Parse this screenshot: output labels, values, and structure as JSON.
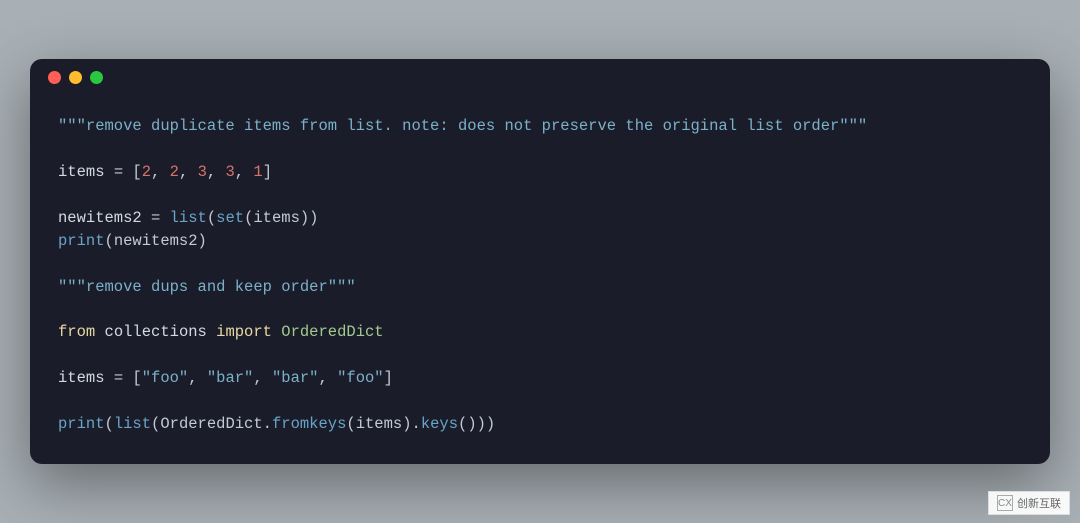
{
  "lines": [
    [
      {
        "cls": "t-str",
        "text": "\"\"\"remove duplicate items from list. note: does not preserve the original list order\"\"\""
      }
    ],
    [
      {
        "cls": "",
        "text": ""
      }
    ],
    [
      {
        "cls": "t-name",
        "text": "items "
      },
      {
        "cls": "t-punc",
        "text": "= ["
      },
      {
        "cls": "t-num",
        "text": "2"
      },
      {
        "cls": "t-punc",
        "text": ", "
      },
      {
        "cls": "t-num",
        "text": "2"
      },
      {
        "cls": "t-punc",
        "text": ", "
      },
      {
        "cls": "t-num",
        "text": "3"
      },
      {
        "cls": "t-punc",
        "text": ", "
      },
      {
        "cls": "t-num",
        "text": "3"
      },
      {
        "cls": "t-punc",
        "text": ", "
      },
      {
        "cls": "t-num",
        "text": "1"
      },
      {
        "cls": "t-punc",
        "text": "]"
      }
    ],
    [
      {
        "cls": "",
        "text": ""
      }
    ],
    [
      {
        "cls": "t-name",
        "text": "newitems2 "
      },
      {
        "cls": "t-punc",
        "text": "= "
      },
      {
        "cls": "t-fn",
        "text": "list"
      },
      {
        "cls": "t-punc",
        "text": "("
      },
      {
        "cls": "t-fn",
        "text": "set"
      },
      {
        "cls": "t-punc",
        "text": "(items))"
      }
    ],
    [
      {
        "cls": "t-fn",
        "text": "print"
      },
      {
        "cls": "t-punc",
        "text": "(newitems2)"
      }
    ],
    [
      {
        "cls": "",
        "text": ""
      }
    ],
    [
      {
        "cls": "t-str",
        "text": "\"\"\"remove dups and keep order\"\"\""
      }
    ],
    [
      {
        "cls": "",
        "text": ""
      }
    ],
    [
      {
        "cls": "t-id",
        "text": "from"
      },
      {
        "cls": "t-punc",
        "text": " "
      },
      {
        "cls": "t-name",
        "text": "collections "
      },
      {
        "cls": "t-id",
        "text": "import"
      },
      {
        "cls": "t-punc",
        "text": " "
      },
      {
        "cls": "t-mod",
        "text": "OrderedDict"
      }
    ],
    [
      {
        "cls": "",
        "text": ""
      }
    ],
    [
      {
        "cls": "t-name",
        "text": "items "
      },
      {
        "cls": "t-punc",
        "text": "= ["
      },
      {
        "cls": "t-str",
        "text": "\"foo\""
      },
      {
        "cls": "t-punc",
        "text": ", "
      },
      {
        "cls": "t-str",
        "text": "\"bar\""
      },
      {
        "cls": "t-punc",
        "text": ", "
      },
      {
        "cls": "t-str",
        "text": "\"bar\""
      },
      {
        "cls": "t-punc",
        "text": ", "
      },
      {
        "cls": "t-str",
        "text": "\"foo\""
      },
      {
        "cls": "t-punc",
        "text": "]"
      }
    ],
    [
      {
        "cls": "",
        "text": ""
      }
    ],
    [
      {
        "cls": "t-fn",
        "text": "print"
      },
      {
        "cls": "t-punc",
        "text": "("
      },
      {
        "cls": "t-fn",
        "text": "list"
      },
      {
        "cls": "t-punc",
        "text": "(OrderedDict."
      },
      {
        "cls": "t-fn",
        "text": "fromkeys"
      },
      {
        "cls": "t-punc",
        "text": "(items)."
      },
      {
        "cls": "t-fn",
        "text": "keys"
      },
      {
        "cls": "t-punc",
        "text": "()))"
      }
    ]
  ],
  "watermark": {
    "logo_text": "CX",
    "brand_text": "创新互联"
  }
}
